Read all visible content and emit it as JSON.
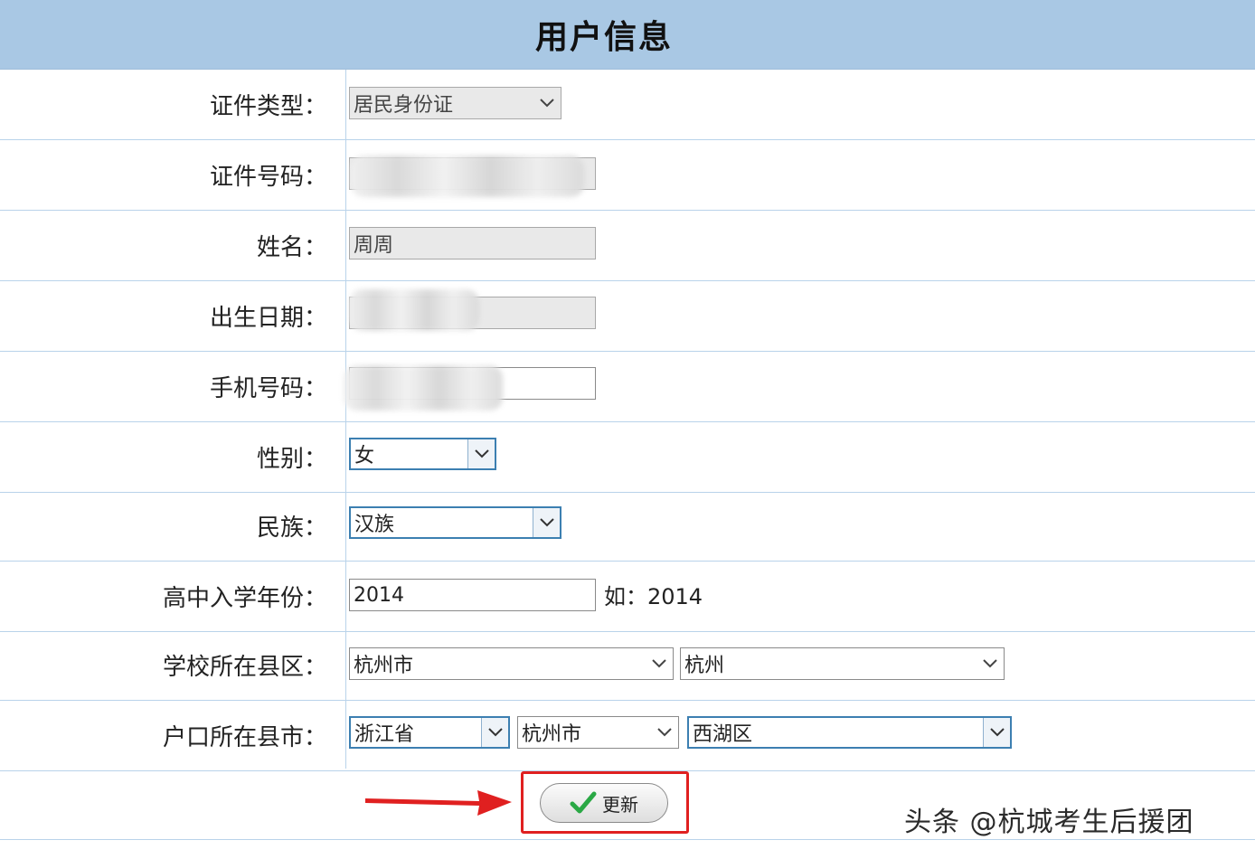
{
  "header": {
    "title": "用户信息"
  },
  "form": {
    "id_type": {
      "label": "证件类型：",
      "value": "居民身份证"
    },
    "id_number": {
      "label": "证件号码：",
      "value": ""
    },
    "name": {
      "label": "姓名：",
      "value": "周周"
    },
    "birth_date": {
      "label": "出生日期：",
      "value": ""
    },
    "phone": {
      "label": "手机号码：",
      "value": ""
    },
    "gender": {
      "label": "性别：",
      "value": "女"
    },
    "ethnicity": {
      "label": "民族：",
      "value": "汉族"
    },
    "enroll_year": {
      "label": "高中入学年份：",
      "value": "2014",
      "hint": "如：2014"
    },
    "school_district": {
      "label": "学校所在县区：",
      "city": "杭州市",
      "district": "杭州"
    },
    "hukou": {
      "label": "户口所在县市：",
      "province": "浙江省",
      "city": "杭州市",
      "district": "西湖区"
    }
  },
  "actions": {
    "update_label": "更新"
  },
  "watermark": "头条 @杭城考生后援团",
  "colors": {
    "header_bg": "#a9c8e4",
    "grid_line": "#b9d3ea",
    "highlight": "#e02020",
    "check": "#2aa845"
  }
}
